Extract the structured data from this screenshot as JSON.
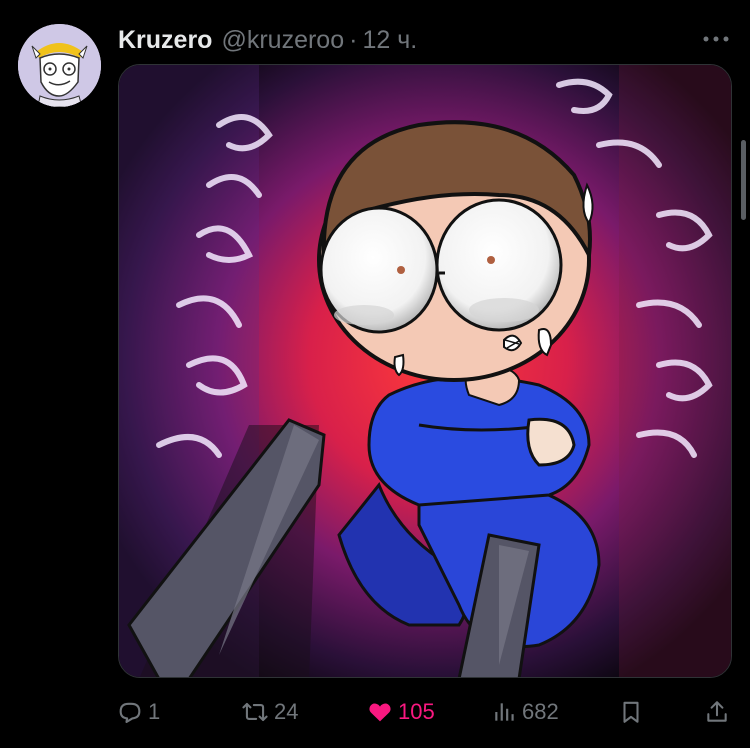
{
  "post": {
    "display_name": "Kruzero",
    "handle": "@kruzeroo",
    "separator": "·",
    "timestamp": "12 ч."
  },
  "media": {
    "image_subject": "drawing"
  },
  "actions": {
    "replies": "1",
    "reposts": "24",
    "likes": "105",
    "views": "682"
  },
  "colors": {
    "background": "#000000",
    "text_primary": "#e7e9ea",
    "text_secondary": "#71767b",
    "like_active": "#f91880",
    "divider": "#2f3336"
  },
  "icons": {
    "avatar": "avatar-image",
    "more": "more-horizontal-icon",
    "reply": "reply-icon",
    "repost": "repost-icon",
    "like": "heart-filled-icon",
    "views": "views-chart-icon",
    "bookmark": "bookmark-icon",
    "share": "share-icon"
  }
}
